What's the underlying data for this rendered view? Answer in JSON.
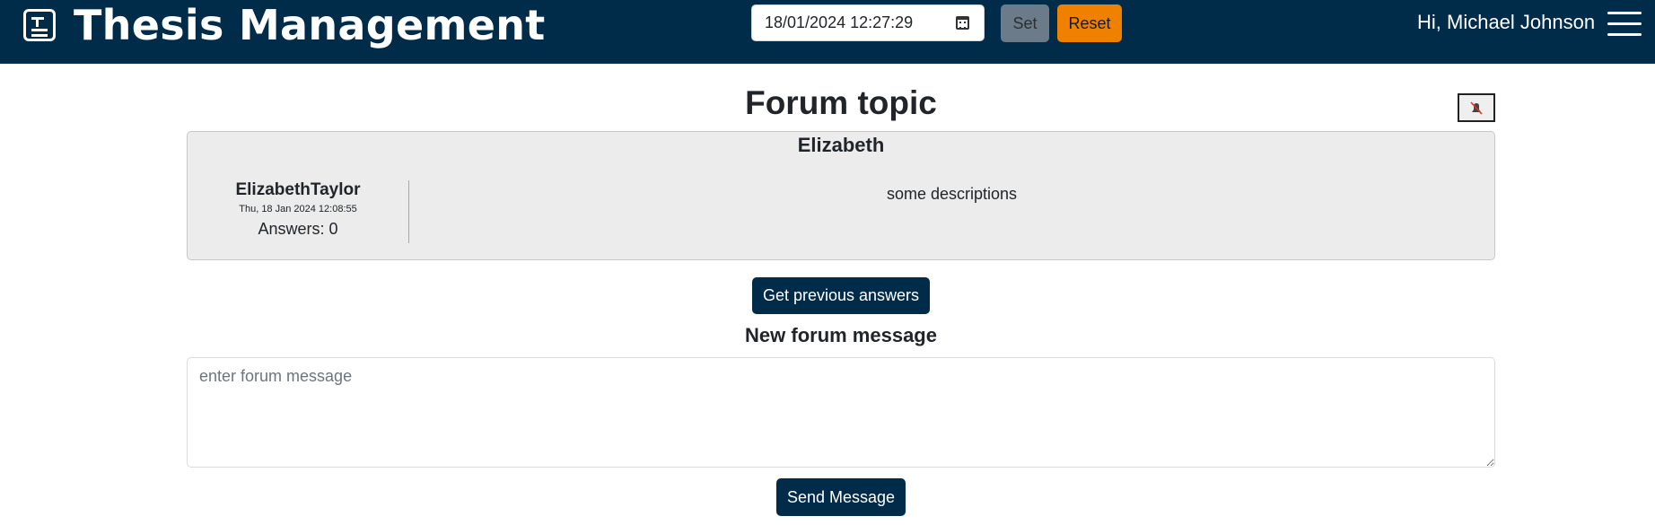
{
  "header": {
    "app_title": "Thesis Management",
    "datetime_value": "18/01/2024 12:27:29",
    "set_label": "Set",
    "reset_label": "Reset",
    "greeting": "Hi, Michael Johnson"
  },
  "page": {
    "title": "Forum topic"
  },
  "topic": {
    "name": "Elizabeth",
    "author": "ElizabethTaylor",
    "date": "Thu, 18 Jan 2024 12:08:55",
    "answers": "Answers: 0",
    "description": "some descriptions"
  },
  "actions": {
    "previous_answers_label": "Get previous answers",
    "new_message_title": "New forum message",
    "message_placeholder": "enter forum message",
    "send_label": "Send Message"
  },
  "colors": {
    "navbar": "#002b49",
    "reset": "#f08000",
    "set": "#6c7b8a"
  }
}
